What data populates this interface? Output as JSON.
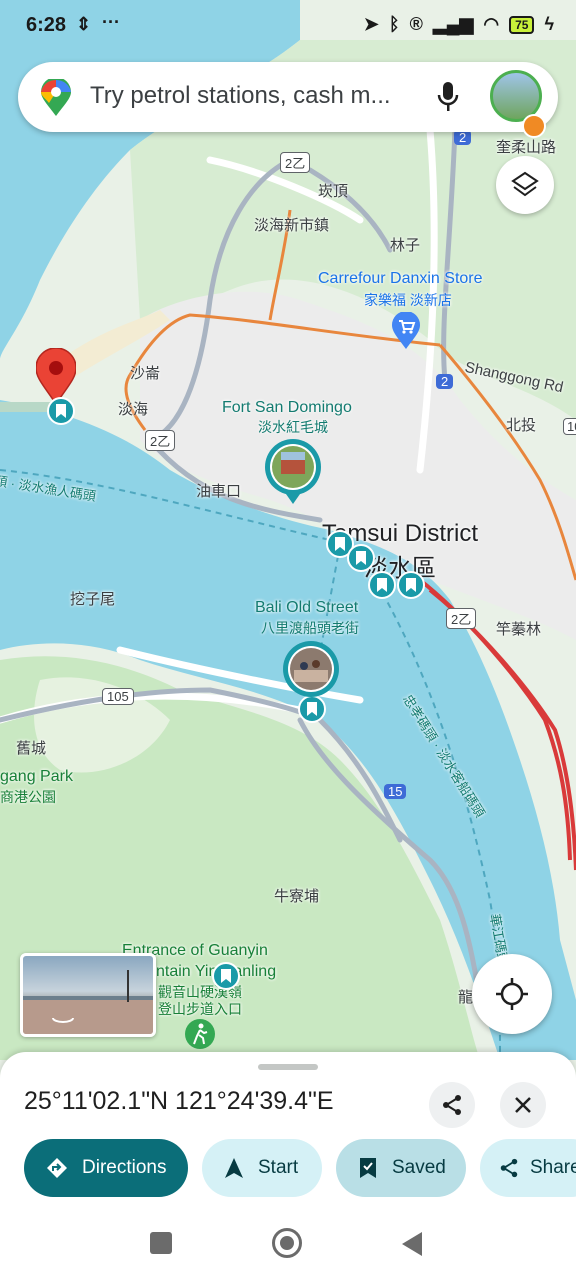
{
  "status_bar": {
    "time": "6:28",
    "battery": "75"
  },
  "search": {
    "placeholder": "Try petrol stations, cash m..."
  },
  "map": {
    "labels": {
      "kanding": "崁頂",
      "danhai_new_town": "淡海新市鎮",
      "linzi": "林子",
      "carrefour_en": "Carrefour Danxin Store",
      "carrefour_zh": "家樂福 淡新店",
      "shazi": "沙崙",
      "danhai": "淡海",
      "fort_en": "Fort San Domingo",
      "fort_zh": "淡水紅毛城",
      "shanggong_rd": "Shanggong Rd",
      "beitou": "北投",
      "youchekou": "油車口",
      "tamsui_en": "Tamsui District",
      "tamsui_zh": "淡水區",
      "wazi_wei": "挖子尾",
      "bali_en": "Bali Old Street",
      "bali_zh": "八里渡船頭老街",
      "zhuwei": "竿蓁林",
      "jiucheng": "舊城",
      "park_en": "gang Park",
      "park_zh": "商港公園",
      "niuliaopu": "牛寮埔",
      "guanyin_en_1": "Entrance of Guanyin",
      "guanyin_en_2": "ntain Yin Danling",
      "guanyin_zh_1": "觀音山硬漢嶺",
      "guanyin_zh_2": "登山步道入口",
      "longxing": "龍",
      "fisherman_wharf": "頭 · 淡水漁人碼頭",
      "zhongxiao_wharf": "忠孝碼頭 · 淡水客船碼頭",
      "huajiang_wharf": "華江碼頭",
      "kuisin_rd": "奎柔山路",
      "route_2z_a": "2乙",
      "route_2z_b": "2乙",
      "route_2z_c": "2乙",
      "route_2_a": "2",
      "route_2_b": "2",
      "route_105": "105",
      "route_15": "15",
      "route_10": "10"
    }
  },
  "place_sheet": {
    "coordinates": "25°11'02.1\"N 121°24'39.4\"E",
    "actions": {
      "directions": "Directions",
      "start": "Start",
      "saved": "Saved",
      "share": "Share"
    }
  },
  "colors": {
    "water": "#8fd3e6",
    "land": "#e9f1e7",
    "park": "#c9e8c2",
    "accent": "#0b6e79",
    "pin": "#ea4335"
  }
}
